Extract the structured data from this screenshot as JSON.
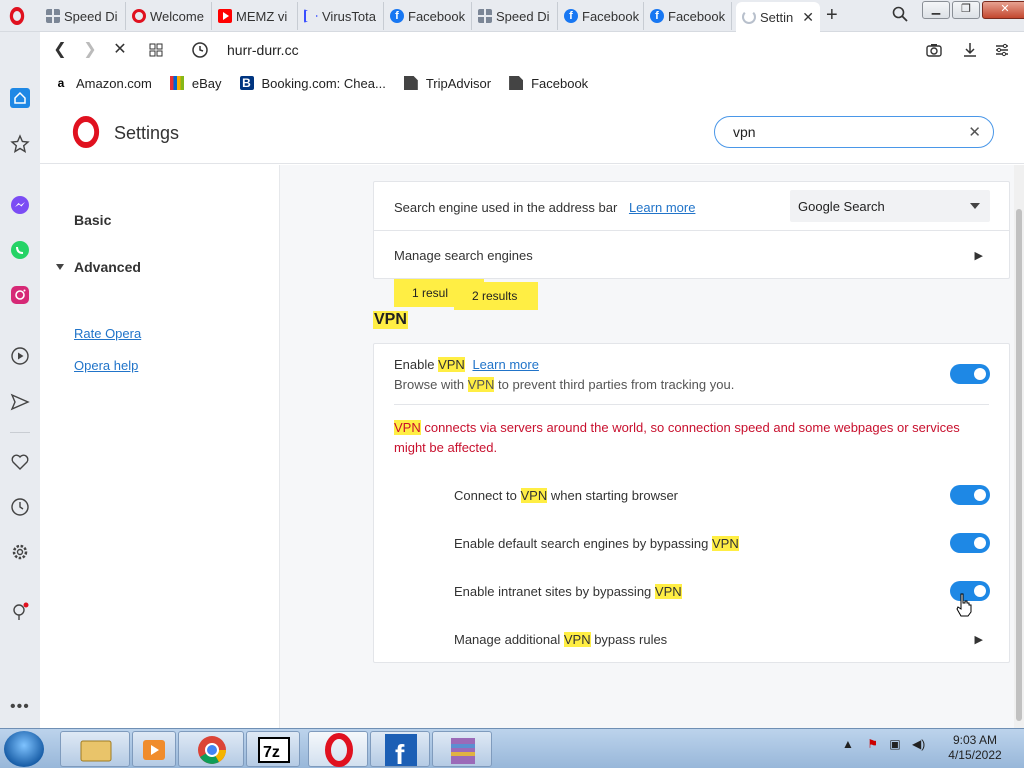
{
  "tabs": [
    {
      "label": "Speed Di",
      "icon": "speed-dial-icon"
    },
    {
      "label": "Welcome",
      "icon": "opera-icon"
    },
    {
      "label": "MEMZ vi",
      "icon": "youtube-icon"
    },
    {
      "label": "VirusTota",
      "icon": "virustotal-icon"
    },
    {
      "label": "Facebook",
      "icon": "facebook-icon"
    },
    {
      "label": "Speed Di",
      "icon": "speed-dial-icon"
    },
    {
      "label": "Facebook",
      "icon": "facebook-icon"
    },
    {
      "label": "Facebook",
      "icon": "facebook-icon"
    },
    {
      "label": "Settin",
      "icon": "loading-icon",
      "active": true
    }
  ],
  "address": {
    "url": "hurr-durr.cc"
  },
  "bookmarks": [
    {
      "label": "Amazon.com",
      "icon": "amazon-icon"
    },
    {
      "label": "eBay",
      "icon": "ebay-icon"
    },
    {
      "label": "Booking.com: Chea...",
      "icon": "booking-icon"
    },
    {
      "label": "TripAdvisor",
      "icon": "page-icon"
    },
    {
      "label": "Facebook",
      "icon": "page-icon"
    }
  ],
  "settings": {
    "title": "Settings",
    "search_value": "vpn"
  },
  "nav": {
    "basic": "Basic",
    "advanced": "Advanced",
    "rate": "Rate Opera",
    "help": "Opera help"
  },
  "search_engine": {
    "label": "Search engine used in the address bar",
    "learn_more": "Learn more",
    "selected": "Google Search",
    "manage": "Manage search engines"
  },
  "bubbles": {
    "one": "1 resul",
    "two": "2 results"
  },
  "vpn": {
    "heading": "VPN",
    "enable_pre": "Enable ",
    "enable_hl": "VPN",
    "learn_more": "Learn more",
    "browse_pre": "Browse with ",
    "browse_hl": "VPN",
    "browse_post": " to prevent third parties from tracking you.",
    "warn_hl": "VPN",
    "warn_text": " connects via servers around the world, so connection speed and some webpages or services might be affected.",
    "opt1_pre": "Connect to ",
    "opt1_hl": "VPN",
    "opt1_post": " when starting browser",
    "opt2_pre": "Enable default search engines by bypassing ",
    "opt2_hl": "VPN",
    "opt3_pre": "Enable intranet sites by bypassing ",
    "opt3_hl": "VPN",
    "opt4_pre": "Manage additional ",
    "opt4_hl": "VPN",
    "opt4_post": " bypass rules",
    "toggles": {
      "enable": true,
      "connect_start": true,
      "default_search": true,
      "intranet": true
    }
  },
  "taskbar": {
    "time": "9:03 AM",
    "date": "4/15/2022",
    "apps": [
      "explorer-icon",
      "media-player-icon",
      "chrome-icon",
      "7zip-icon",
      "opera-icon",
      "facebook-icon",
      "winrar-icon"
    ]
  },
  "colors": {
    "accent": "#1e88e5",
    "highlight": "#ffee44",
    "warning": "#c8102e",
    "opera_red": "#e0111f"
  }
}
